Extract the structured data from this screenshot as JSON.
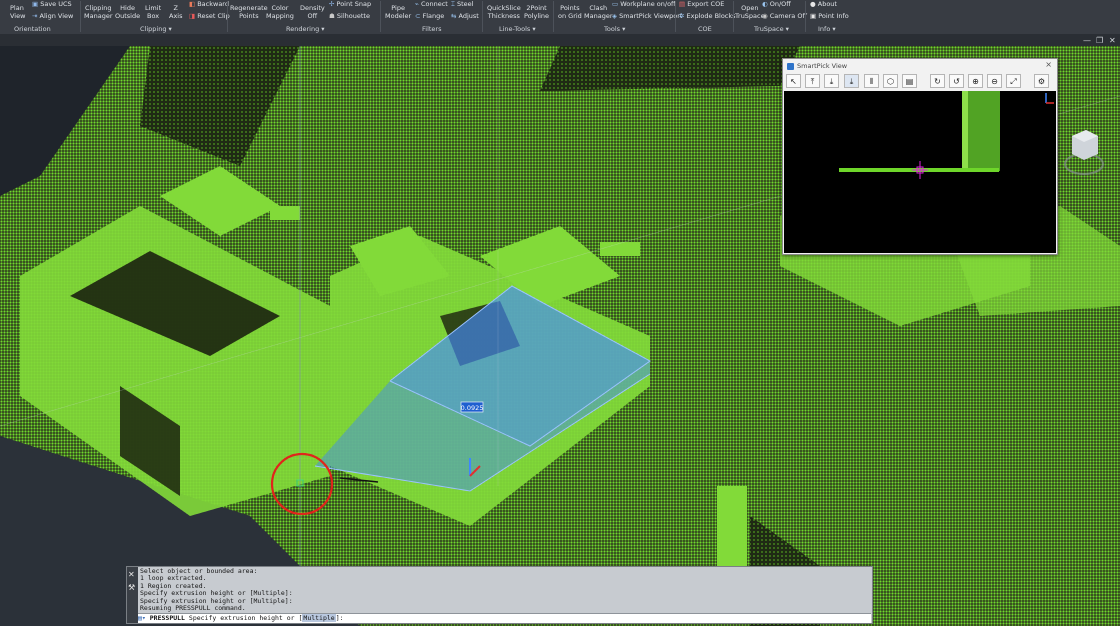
{
  "ribbon": {
    "orientation": {
      "plan_view_1": "Plan",
      "plan_view_2": "View",
      "save_ucs": "Save UCS",
      "align_view": "Align View",
      "group": "Orientation"
    },
    "clipping": {
      "clipping_manager_1": "Clipping",
      "clipping_manager_2": "Manager",
      "hide_outside_1": "Hide",
      "hide_outside_2": "Outside",
      "limit_box_1": "Limit",
      "limit_box_2": "Box",
      "z_axis_1": "Z",
      "z_axis_2": "Axis",
      "backward": "Backward",
      "reset_clip": "Reset Clip",
      "group": "Clipping ▾"
    },
    "rendering": {
      "regenerate_1": "Regenerate",
      "regenerate_2": "Points",
      "color_mapping_1": "Color",
      "color_mapping_2": "Mapping",
      "density_1": "Density",
      "density_2": "Off",
      "point_snap": "Point Snap",
      "silhouette": "Silhouette",
      "group": "Rendering ▾"
    },
    "filters": {
      "pipe_modeler_1": "Pipe",
      "pipe_modeler_2": "Modeler",
      "connect": "Connect",
      "flange": "Flange",
      "steel": "Steel",
      "adjust": "Adjust",
      "group": "Filters"
    },
    "linetools": {
      "quickslice_1": "QuickSlice",
      "quickslice_2": "Thickness",
      "polyline_1": "2Point",
      "polyline_2": "Polyline",
      "group": "Line-Tools ▾"
    },
    "tools": {
      "points_on_grid_1": "Points",
      "points_on_grid_2": "on Grid",
      "clash_manager_1": "Clash",
      "clash_manager_2": "Manager",
      "workplane": "Workplane on/off",
      "smartpick_viewport": "SmartPick Viewport",
      "group": "Tools ▾"
    },
    "coe": {
      "export_coe": "Export COE",
      "explode_blocks": "Explode Blocks",
      "group": "COE"
    },
    "truspace": {
      "open_1": "Open",
      "open_2": "TruSpace",
      "onoff": "On/Off",
      "camera_off": "Camera Off",
      "group": "TruSpace ▾"
    },
    "info": {
      "about": "About",
      "point_info": "Point Info",
      "group": "Info ▾"
    }
  },
  "window_buttons": {
    "minimize": "—",
    "restore": "❐",
    "close": "✕"
  },
  "viewport": {
    "dimension_value": "0.0925"
  },
  "smartpick": {
    "title": "SmartPick View",
    "close": "×",
    "tools": [
      "select-icon",
      "top-view-icon",
      "down-view-icon",
      "align-down-icon",
      "columns-icon",
      "cube-icon",
      "save-icon",
      "rotate-cw-icon",
      "rotate-ccw-icon",
      "zoom-in-icon",
      "zoom-out-icon",
      "zoom-extents-icon",
      "settings-icon"
    ],
    "tool_glyphs": [
      "↖",
      "⤒",
      "⤓",
      "⤓",
      "⦀",
      "⬡",
      "▤",
      "↻",
      "↺",
      "⊕",
      "⊖",
      "⤢",
      "⚙"
    ]
  },
  "command": {
    "history": [
      "Select object or bounded area:",
      "1 loop extracted.",
      "1 Region created.",
      "Specify extrusion height or [Multiple]:",
      "Specify extrusion height or [Multiple]:",
      "Resuming PRESSPULL command."
    ],
    "prompt_command": "PRESSPULL",
    "prompt_text": "Specify extrusion height or [",
    "prompt_option": "Multiple",
    "prompt_end": "]:"
  },
  "colors": {
    "ribbon": "#383c43",
    "pointcloud": "#6ed62a",
    "selection": "#3f86ff",
    "circle": "#e0251b",
    "background": "#2b3139"
  }
}
